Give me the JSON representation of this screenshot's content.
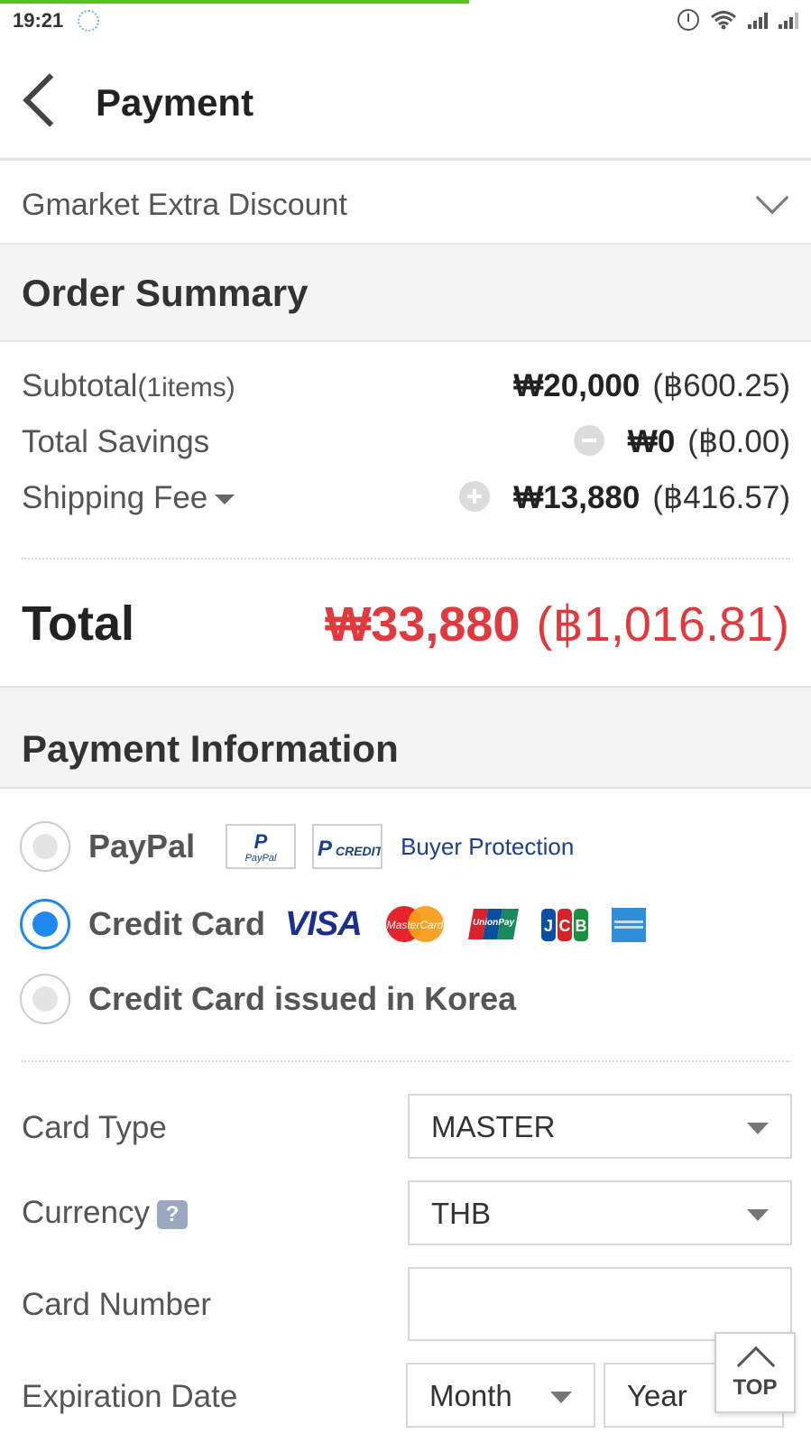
{
  "status_bar": {
    "time": "19:21",
    "icons": [
      "sync-icon",
      "alarm-icon",
      "wifi-icon",
      "signal-icon",
      "signal-icon"
    ],
    "progress_color": "#5ac31a"
  },
  "header": {
    "title": "Payment"
  },
  "discount": {
    "label": "Gmarket Extra Discount"
  },
  "order_summary": {
    "heading": "Order Summary",
    "subtotal": {
      "label": "Subtotal",
      "items": "(1items)",
      "krw": "₩20,000",
      "thb": "(฿600.25)"
    },
    "savings": {
      "label": "Total Savings",
      "krw": "₩0",
      "thb": "(฿0.00)"
    },
    "shipping": {
      "label": "Shipping Fee",
      "krw": "₩13,880",
      "thb": "(฿416.57)"
    },
    "total": {
      "label": "Total",
      "krw": "₩33,880",
      "thb": "(฿1,016.81)",
      "color": "#e0393e"
    }
  },
  "payment_info": {
    "heading": "Payment Information",
    "options": [
      {
        "label": "PayPal",
        "selected": false,
        "link": "Buyer Protection"
      },
      {
        "label": "Credit Card",
        "selected": true,
        "brands": [
          "VISA",
          "MasterCard",
          "UnionPay",
          "JCB",
          "American Express"
        ]
      },
      {
        "label": "Credit Card issued in Korea",
        "selected": false
      }
    ],
    "accent_color": "#1e88f0"
  },
  "form": {
    "card_type": {
      "label": "Card Type",
      "value": "MASTER"
    },
    "currency": {
      "label": "Currency",
      "value": "THB",
      "help": "?"
    },
    "card_number": {
      "label": "Card Number",
      "value": ""
    },
    "expiration": {
      "label": "Expiration Date",
      "month": "Month",
      "year": "Year"
    }
  },
  "top_button": {
    "label": "TOP"
  }
}
